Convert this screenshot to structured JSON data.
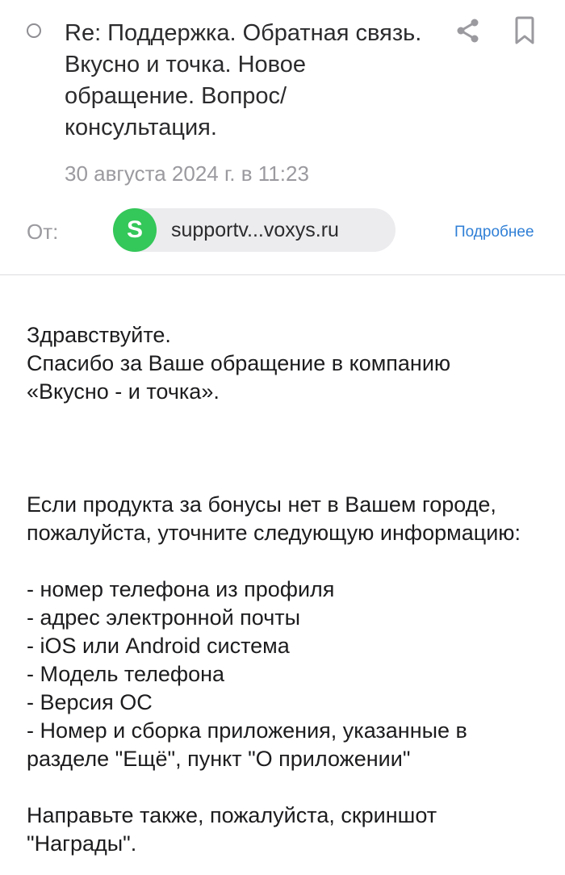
{
  "header": {
    "subject": "Re: Поддержка. Обратная связь. Вкусно и точка. Новое обращение. Вопрос/консультация.",
    "date": "30 августа 2024 г. в 11:23",
    "from_label": "От:",
    "sender": {
      "avatar_letter": "S",
      "avatar_color": "#34c759",
      "address": "supportv...voxys.ru"
    },
    "details_label": "Подробнее",
    "icons": [
      "unread-dot-icon",
      "share-icon",
      "bookmark-icon"
    ]
  },
  "body": {
    "greeting": "Здравствуйте.",
    "thanks_line1": "Спасибо за Ваше обращение в компанию",
    "thanks_line2": "«Вкусно - и точка».",
    "request": "Если продукта за бонусы нет в Вашем городе, пожалуйста, уточните следующую информацию:",
    "items": [
      "- номер телефона из профиля",
      "- адрес электронной почты",
      "- iOS или Android система",
      "- Модель телефона",
      "- Версия ОС",
      "- Номер и сборка приложения, указанные в разделе \"Ещё\", пункт \"О приложении\""
    ],
    "closing": "Направьте также, пожалуйста, скриншот \"Награды\"."
  },
  "colors": {
    "accent_link": "#2f7fd6",
    "muted_text": "#9a9a9f",
    "chip_bg": "#ececef"
  }
}
